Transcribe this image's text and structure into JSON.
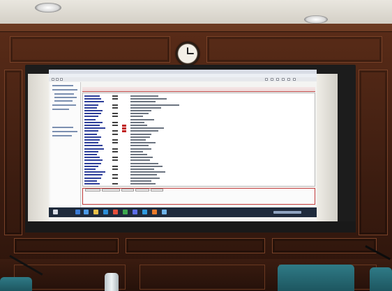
{
  "scene": {
    "content": "",
    "projected_app": {
      "title_bar": "",
      "header": "",
      "left_pane_items": [],
      "fields": [],
      "bottom_tabs": []
    }
  },
  "colors": {
    "wood_wall": "#4a2414",
    "screen": "#f4f4f2",
    "label_blue": "#2e3f9a",
    "flag_red": "#c01e1e",
    "taskbar": "#1f2b3c",
    "chair_teal": "#2f7a86"
  }
}
